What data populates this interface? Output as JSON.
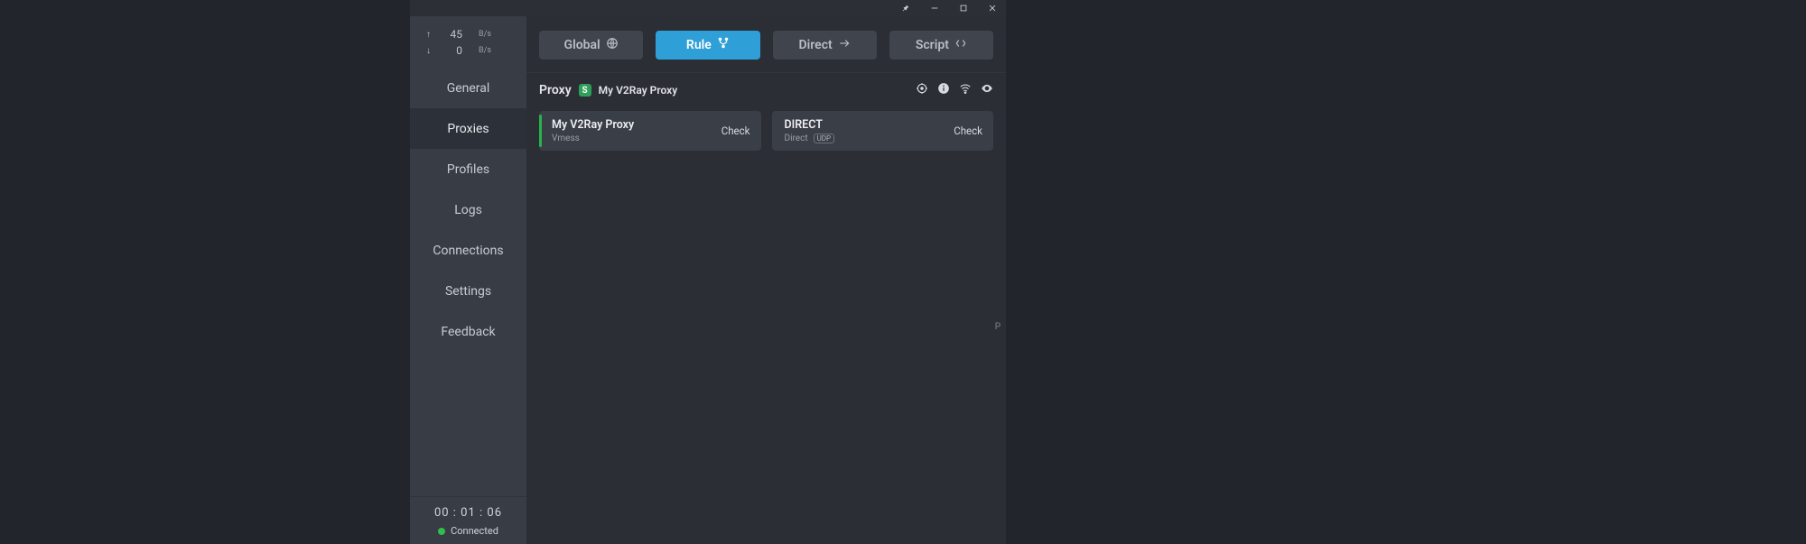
{
  "titlebar": {
    "pin_title": "Pin",
    "min_title": "Minimize",
    "max_title": "Maximize",
    "close_title": "Close"
  },
  "speed": {
    "up_value": "45",
    "up_unit": "B/s",
    "down_value": "0",
    "down_unit": "B/s"
  },
  "nav": {
    "items": [
      {
        "label": "General"
      },
      {
        "label": "Proxies"
      },
      {
        "label": "Profiles"
      },
      {
        "label": "Logs"
      },
      {
        "label": "Connections"
      },
      {
        "label": "Settings"
      },
      {
        "label": "Feedback"
      }
    ],
    "active_index": 1
  },
  "status": {
    "time": "00 : 01 : 06",
    "label": "Connected"
  },
  "modes": {
    "items": [
      {
        "label": "Global"
      },
      {
        "label": "Rule"
      },
      {
        "label": "Direct"
      },
      {
        "label": "Script"
      }
    ],
    "active_index": 1
  },
  "group": {
    "title": "Proxy",
    "badge": "S",
    "subtitle": "My V2Ray Proxy"
  },
  "cards": [
    {
      "title": "My V2Ray Proxy",
      "subtitle": "Vmess",
      "udp": false,
      "active": true,
      "check": "Check"
    },
    {
      "title": "DIRECT",
      "subtitle": "Direct",
      "udp": true,
      "active": false,
      "check": "Check"
    }
  ],
  "side_letter": "P"
}
